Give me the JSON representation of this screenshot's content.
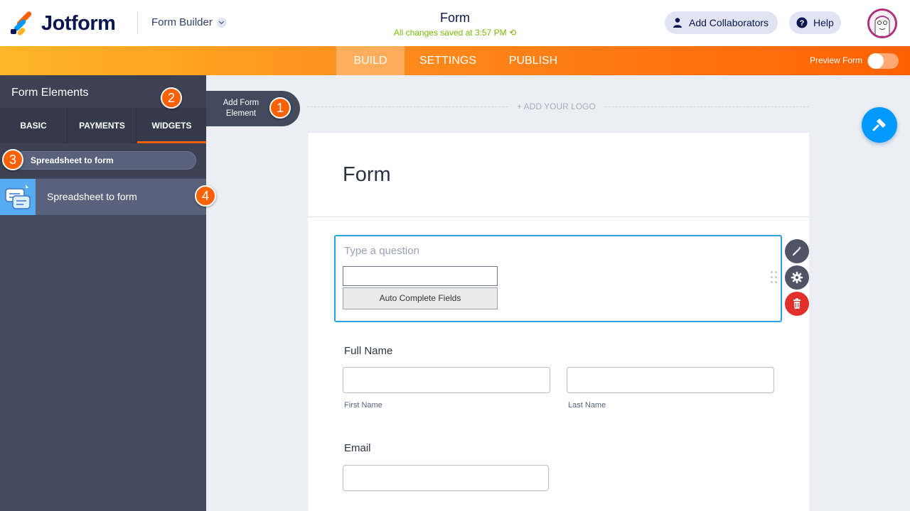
{
  "header": {
    "brand": "Jotform",
    "builder_select": "Form Builder",
    "form_title": "Form",
    "save_status": "All changes saved at 3:57 PM",
    "collaborators_label": "Add Collaborators",
    "help_label": "Help"
  },
  "nav": {
    "tabs": [
      "BUILD",
      "SETTINGS",
      "PUBLISH"
    ],
    "active": "BUILD",
    "preview_label": "Preview Form",
    "preview_enabled": false
  },
  "sidebar": {
    "title": "Form Elements",
    "tabs": [
      "BASIC",
      "PAYMENTS",
      "WIDGETS"
    ],
    "active_tab": "WIDGETS",
    "search_value": "Spreadsheet to form",
    "results": [
      {
        "label": "Spreadsheet to form"
      }
    ]
  },
  "steps": [
    "1",
    "2",
    "3",
    "4"
  ],
  "add_element": {
    "line1": "Add Form",
    "line2": "Element"
  },
  "canvas": {
    "add_logo": "+ ADD YOUR LOGO",
    "form_heading": "Form",
    "question": {
      "placeholder": "Type a question",
      "button_label": "Auto Complete Fields"
    },
    "full_name": {
      "label": "Full Name",
      "first_sub": "First Name",
      "last_sub": "Last Name"
    },
    "email": {
      "label": "Email"
    }
  },
  "colors": {
    "accent": "#ff6100",
    "brand_blue": "#0099ff",
    "sidebar": "#434a5e",
    "save_green": "#78bb07",
    "delete_red": "#e2312b"
  }
}
